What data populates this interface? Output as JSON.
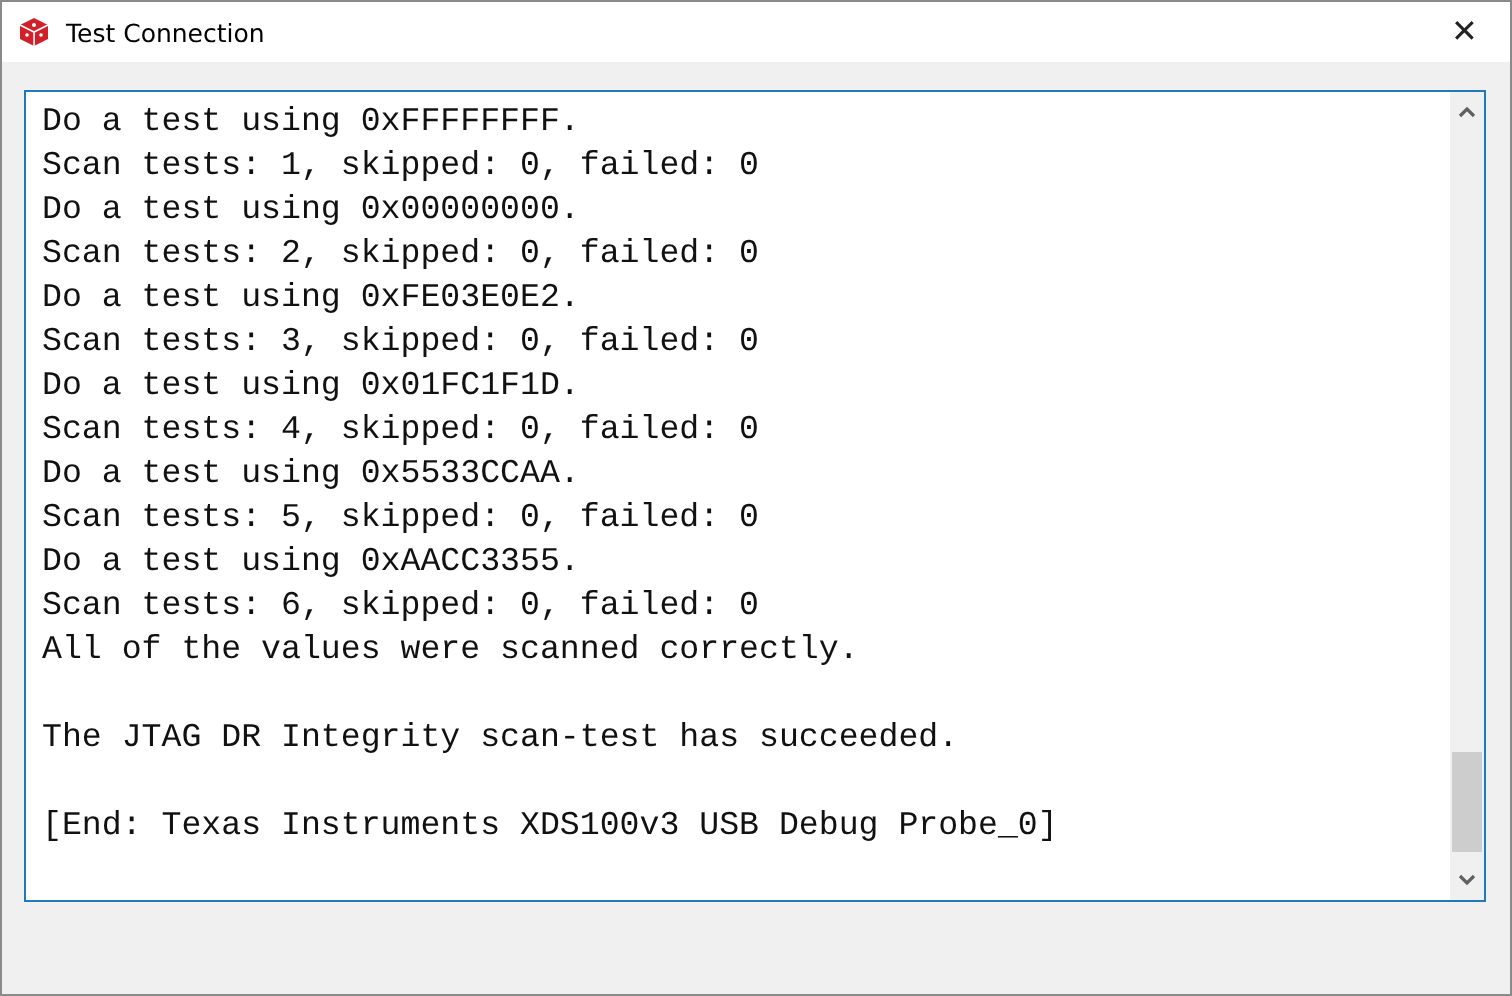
{
  "window": {
    "title": "Test Connection",
    "close": "✕"
  },
  "output": {
    "blocks": [
      [
        "Do a test using 0xFFFFFFFF.",
        "Scan tests: 1, skipped: 0, failed: 0",
        "Do a test using 0x00000000.",
        "Scan tests: 2, skipped: 0, failed: 0",
        "Do a test using 0xFE03E0E2.",
        "Scan tests: 3, skipped: 0, failed: 0",
        "Do a test using 0x01FC1F1D.",
        "Scan tests: 4, skipped: 0, failed: 0",
        "Do a test using 0x5533CCAA.",
        "Scan tests: 5, skipped: 0, failed: 0",
        "Do a test using 0xAACC3355.",
        "Scan tests: 6, skipped: 0, failed: 0",
        "All of the values were scanned correctly."
      ],
      [
        "The JTAG DR Integrity scan-test has succeeded."
      ],
      [
        "[End: Texas Instruments XDS100v3 USB Debug Probe_0]"
      ]
    ]
  }
}
